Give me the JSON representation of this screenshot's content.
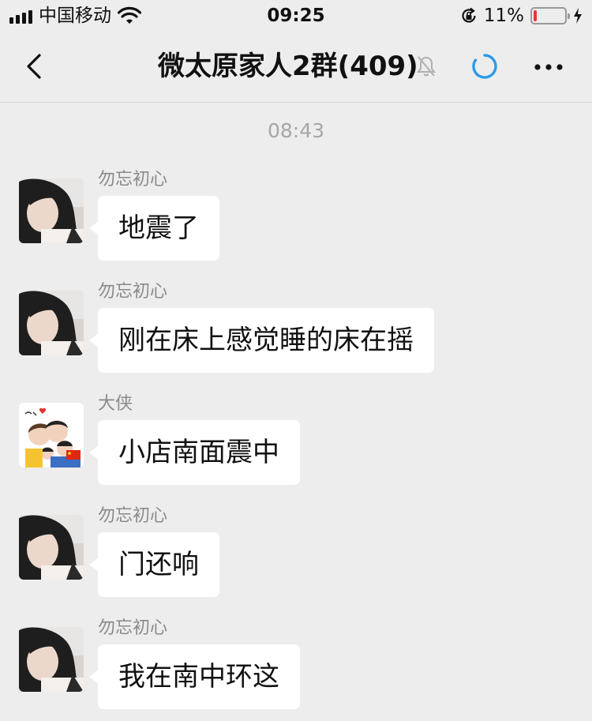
{
  "status_bar": {
    "carrier": "中国移动",
    "time": "09:25",
    "battery_percent": "11%",
    "battery_level": 0.11,
    "icons": [
      "signal-icon",
      "wifi-icon",
      "rotation-lock-icon",
      "battery-icon",
      "charging-bolt-icon"
    ]
  },
  "nav": {
    "title": "微太原家人2群(409)",
    "icons": [
      "back-arrow-icon",
      "mute-bell-icon",
      "loading-icon",
      "more-icon"
    ]
  },
  "chat": {
    "timestamp": "08:43",
    "messages": [
      {
        "sender": "勿忘初心",
        "text": "地震了",
        "avatar": "photo-avatar"
      },
      {
        "sender": "勿忘初心",
        "text": "刚在床上感觉睡的床在摇",
        "avatar": "photo-avatar"
      },
      {
        "sender": "大侠",
        "text": "小店南面震中",
        "avatar": "cartoon-family-avatar"
      },
      {
        "sender": "勿忘初心",
        "text": "门还响",
        "avatar": "photo-avatar"
      },
      {
        "sender": "勿忘初心",
        "text": "我在南中环这",
        "avatar": "photo-avatar"
      }
    ]
  },
  "colors": {
    "background": "#ededed",
    "bubble": "#ffffff",
    "accent_blue": "#2b9be8",
    "battery_red": "#e33333"
  }
}
